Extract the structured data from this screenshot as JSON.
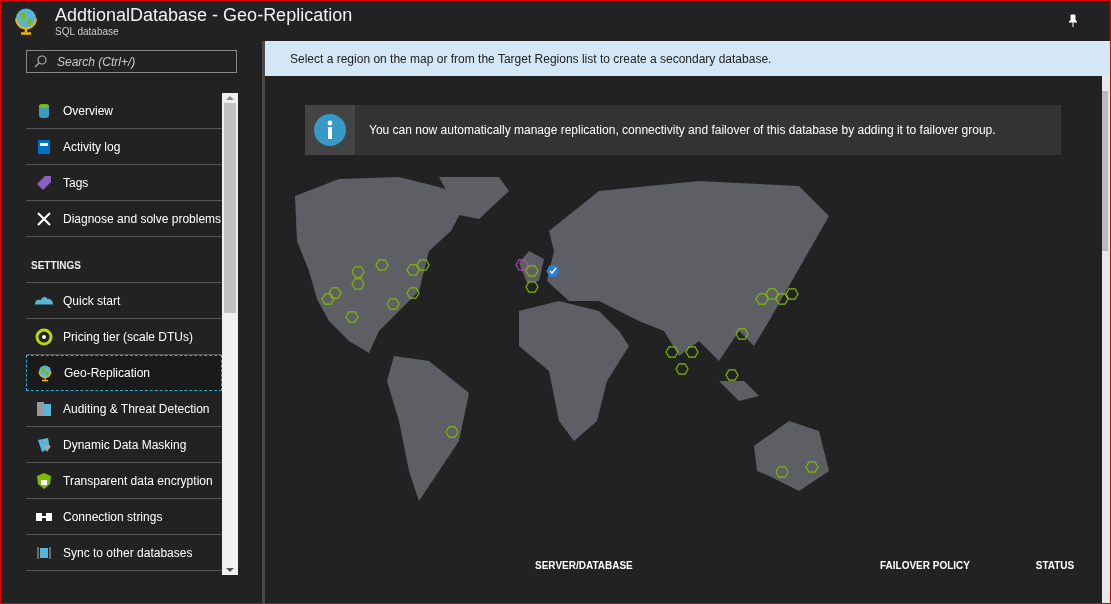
{
  "window": {
    "title": "AddtionalDatabase - Geo-Replication",
    "subtitle": "SQL database"
  },
  "search": {
    "placeholder": "Search (Ctrl+/)"
  },
  "menu": [
    {
      "kind": "item",
      "label": "Overview",
      "selected": false
    },
    {
      "kind": "item",
      "label": "Activity log",
      "selected": false
    },
    {
      "kind": "item",
      "label": "Tags",
      "selected": false
    },
    {
      "kind": "item",
      "label": "Diagnose and solve problems",
      "selected": false
    },
    {
      "kind": "header",
      "label": "SETTINGS"
    },
    {
      "kind": "item",
      "label": "Quick start",
      "selected": false
    },
    {
      "kind": "item",
      "label": "Pricing tier (scale DTUs)",
      "selected": false
    },
    {
      "kind": "item",
      "label": "Geo-Replication",
      "selected": true
    },
    {
      "kind": "item",
      "label": "Auditing & Threat Detection",
      "selected": false
    },
    {
      "kind": "item",
      "label": "Dynamic Data Masking",
      "selected": false
    },
    {
      "kind": "item",
      "label": "Transparent data encryption",
      "selected": false
    },
    {
      "kind": "item",
      "label": "Connection strings",
      "selected": false
    },
    {
      "kind": "item",
      "label": "Sync to other databases",
      "selected": false
    }
  ],
  "banner": "Select a region on the map or from the Target Regions list to create a secondary database.",
  "notice": "You can now automatically manage replication, connectivity and failover of this database by adding it to failover group.",
  "table": {
    "columns": [
      "SERVER/DATABASE",
      "FAILOVER POLICY",
      "STATUS"
    ]
  }
}
